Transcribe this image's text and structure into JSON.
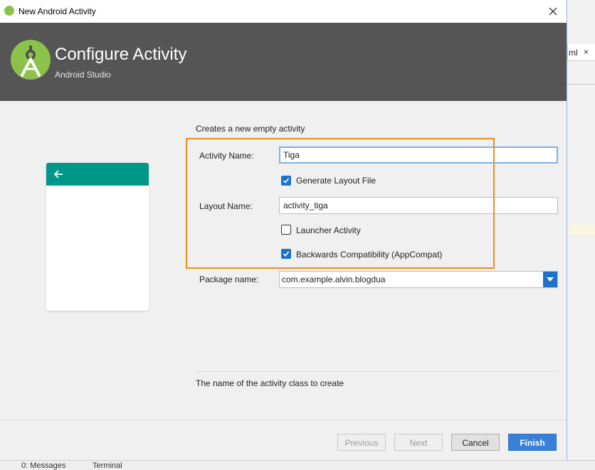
{
  "window": {
    "title": "New Android Activity"
  },
  "header": {
    "title": "Configure Activity",
    "subtitle": "Android Studio"
  },
  "form": {
    "description": "Creates a new empty activity",
    "activity_name_label": "Activity Name:",
    "activity_name_value": "Tiga",
    "generate_layout_label": "Generate Layout File",
    "generate_layout_checked": true,
    "layout_name_label": "Layout Name:",
    "layout_name_value": "activity_tiga",
    "launcher_label": "Launcher Activity",
    "launcher_checked": false,
    "backwards_label": "Backwards Compatibility (AppCompat)",
    "backwards_checked": true,
    "package_label": "Package name:",
    "package_value": "com.example.alvin.blogdua",
    "hint": "The name of the activity class to create"
  },
  "buttons": {
    "previous": "Previous",
    "next": "Next",
    "cancel": "Cancel",
    "finish": "Finish"
  },
  "background": {
    "tab_label": "ml",
    "tab_close": "×",
    "messages": "0: Messages",
    "terminal": "Terminal"
  },
  "colors": {
    "header_bg": "#555555",
    "accent_blue": "#1e73c9",
    "preview_bar": "#009688",
    "annotation": "#f08c1e",
    "android_green": "#8bc34a"
  }
}
